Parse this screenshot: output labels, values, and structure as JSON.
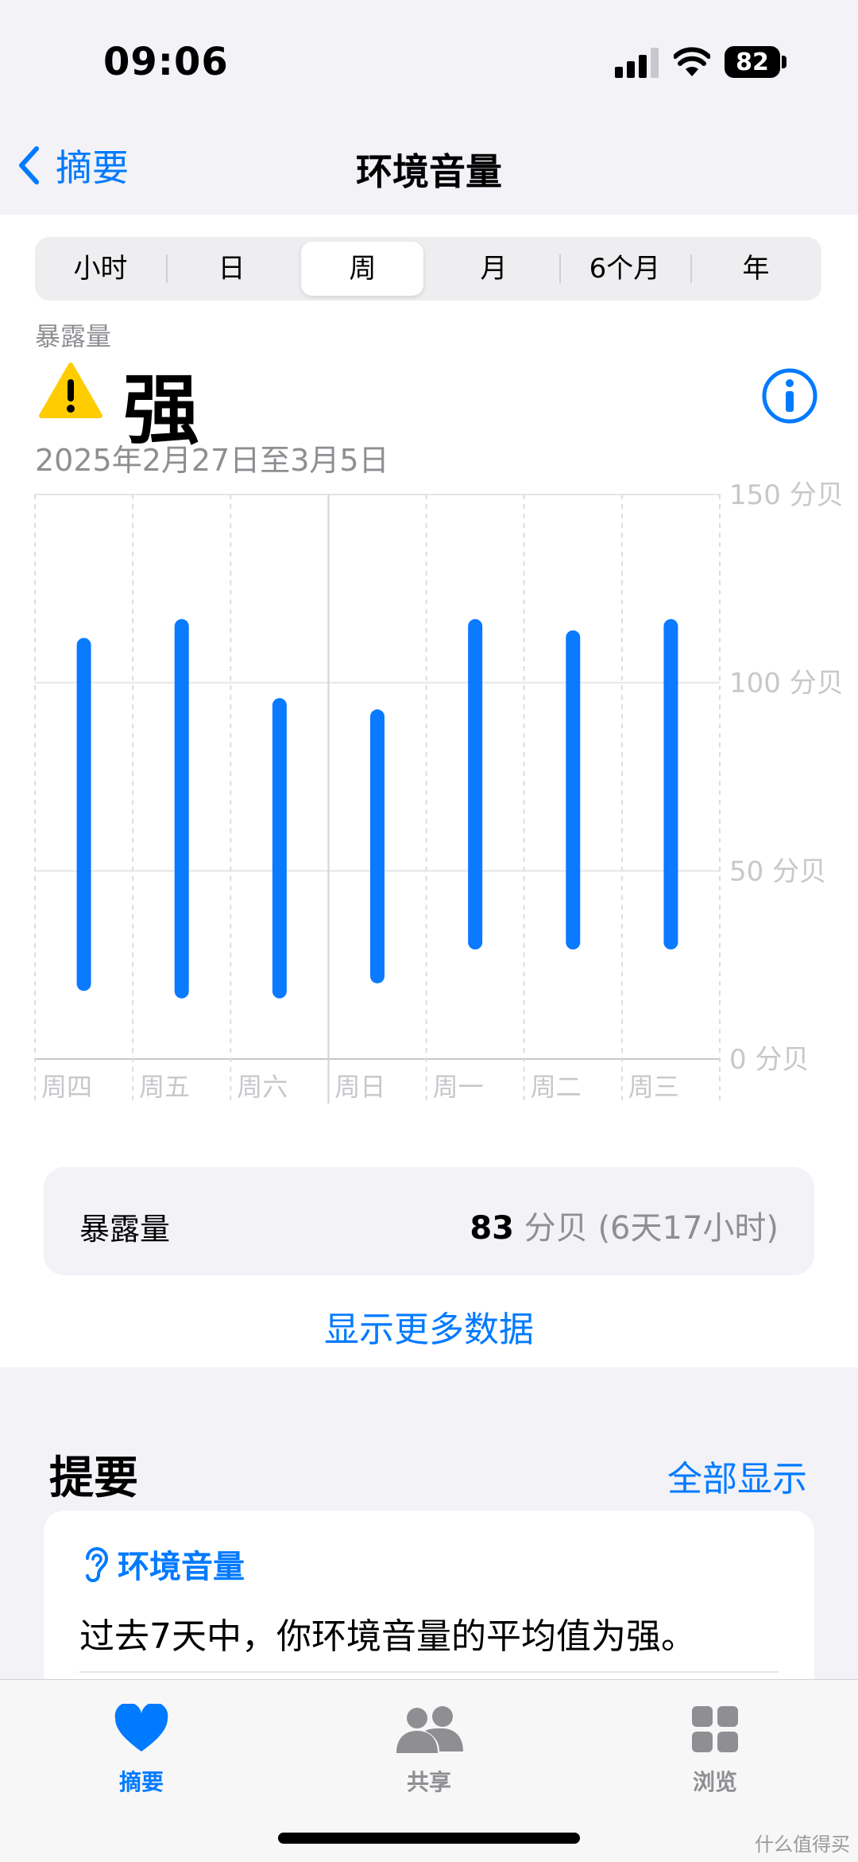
{
  "status": {
    "time": "09:06",
    "battery": "82"
  },
  "nav": {
    "back_label": "摘要",
    "title": "环境音量"
  },
  "segments": {
    "items": [
      "小时",
      "日",
      "周",
      "月",
      "6个月",
      "年"
    ],
    "selected": "周"
  },
  "summary": {
    "label": "暴露量",
    "level": "强",
    "date_range": "2025年2月27日至3月5日",
    "icons": [
      "warning-icon",
      "info-icon"
    ]
  },
  "chart_data": {
    "type": "bar",
    "categories": [
      "周四",
      "周五",
      "周六",
      "周日",
      "周一",
      "周二",
      "周三"
    ],
    "ranges": [
      [
        20,
        110
      ],
      [
        18,
        115
      ],
      [
        18,
        94
      ],
      [
        22,
        91
      ],
      [
        31,
        115
      ],
      [
        31,
        112
      ],
      [
        31,
        115
      ]
    ],
    "ylim": [
      0,
      150
    ],
    "yticks": [
      0,
      50,
      100,
      150
    ],
    "ytick_labels": [
      "0 分贝",
      "50 分贝",
      "100 分贝",
      "150 分贝"
    ],
    "bar_color": "#0a7aff",
    "grid": true
  },
  "exposure": {
    "label": "暴露量",
    "value": "83",
    "unit": "分贝",
    "duration": "(6天17小时)"
  },
  "show_more": "显示更多数据",
  "highlights": {
    "title": "提要",
    "show_all": "全部显示",
    "card": {
      "category": "环境音量",
      "text": "过去7天中，你环境音量的平均值为强。"
    }
  },
  "tabs": [
    {
      "label": "摘要",
      "icon": "heart-icon",
      "active": true
    },
    {
      "label": "共享",
      "icon": "people-icon",
      "active": false
    },
    {
      "label": "浏览",
      "icon": "grid-icon",
      "active": false
    }
  ],
  "watermark": "什么值得买",
  "colors": {
    "accent": "#007aff",
    "warning": "#ffcc00"
  }
}
